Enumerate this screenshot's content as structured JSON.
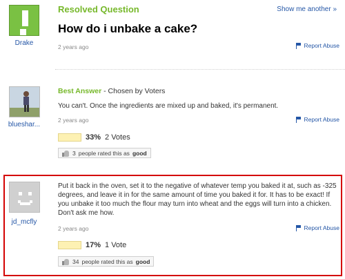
{
  "question": {
    "status_label": "Resolved Question",
    "show_another": "Show me another »",
    "title": "How do i unbake a cake?",
    "time": "2 years ago",
    "report": "Report Abuse",
    "asker": "Drake",
    "avatar_color": "#7ac143"
  },
  "best_answer": {
    "label": "Best Answer",
    "chosen_by": "- Chosen by Voters",
    "text": "You can't. Once the ingredients are mixed up and baked, it's permanent.",
    "time": "2 years ago",
    "report": "Report Abuse",
    "user": "blueshar...",
    "vote_pct": "33%",
    "vote_count": "2 Votes",
    "vote_fraction": 0.33,
    "rated_count": "3",
    "rated_text": "people rated this as",
    "rated_good": "good"
  },
  "other_answer": {
    "text": "Put it back in the oven, set it to the negative of whatever temp you baked it at, such as -325 degrees, and leave it in for the same amount of time you baked it for. It has to be exact! If you unbake it too much the flour may turn into wheat and the eggs will turn into a chicken. Don't ask me how.",
    "time": "2 years ago",
    "report": "Report Abuse",
    "user": "jd_mcfly",
    "vote_pct": "17%",
    "vote_count": "1 Vote",
    "vote_fraction": 0.17,
    "rated_count": "34",
    "rated_text": "people rated this as",
    "rated_good": "good",
    "highlight_color": "#d40000"
  },
  "colors": {
    "green": "#76b82a",
    "link_blue": "#2456a6",
    "red_border": "#d40000"
  }
}
